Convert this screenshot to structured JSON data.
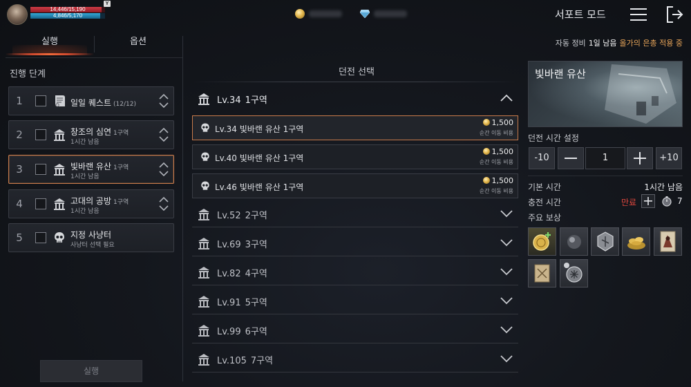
{
  "player": {
    "hp_text": "14,446/15,190",
    "hp_fraction": 0.951,
    "mp_text": "4,846/5,170",
    "mp_fraction": 0.937,
    "badge": "Y"
  },
  "header": {
    "mode_label": "서포트 모드"
  },
  "left": {
    "tabs": [
      {
        "label": "실행",
        "active": true
      },
      {
        "label": "옵션",
        "active": false
      }
    ],
    "section_title": "진행 단계",
    "stages": [
      {
        "num": "1",
        "name": "일일 퀘스트",
        "level": "(12/12)",
        "sub": "",
        "icon": "scroll-icon"
      },
      {
        "num": "2",
        "name": "창조의 심연",
        "level": "1구역",
        "sub": "1시간 남음",
        "icon": "temple-icon"
      },
      {
        "num": "3",
        "name": "빛바랜 유산",
        "level": "1구역",
        "sub": "1시간 남음",
        "icon": "temple-icon"
      },
      {
        "num": "4",
        "name": "고대의 공방",
        "level": "1구역",
        "sub": "1시간 남음",
        "icon": "temple-icon"
      },
      {
        "num": "5",
        "name": "지정 사냥터",
        "level": "",
        "sub": "사냥터 선택 필요",
        "icon": "skull-icon"
      }
    ],
    "run_button": "실행"
  },
  "middle": {
    "title": "던전 선택",
    "open_zone": {
      "level": "Lv.34",
      "name": "1구역"
    },
    "dungeons": [
      {
        "name": "Lv.34 빛바랜 유산 1구역",
        "cost": "1,500",
        "cost_label": "순간 이동 비용"
      },
      {
        "name": "Lv.40 빛바랜 유산 1구역",
        "cost": "1,500",
        "cost_label": "순간 이동 비용"
      },
      {
        "name": "Lv.46 빛바랜 유산 1구역",
        "cost": "1,500",
        "cost_label": "순간 이동 비용"
      }
    ],
    "zones": [
      {
        "level": "Lv.52",
        "name": "2구역"
      },
      {
        "level": "Lv.69",
        "name": "3구역"
      },
      {
        "level": "Lv.82",
        "name": "4구역"
      },
      {
        "level": "Lv.91",
        "name": "5구역"
      },
      {
        "level": "Lv.99",
        "name": "6구역"
      },
      {
        "level": "Lv.105",
        "name": "7구역"
      }
    ]
  },
  "right": {
    "maintenance_label": "자동 정비",
    "maintenance_value": "1일 남음",
    "event_text": "올가의 은총 적용 중",
    "map_title": "빛바랜 유산",
    "time_setting_label": "던전 시간 설정",
    "minus10": "-10",
    "plus10": "+10",
    "hours_value": "1",
    "base_time_label": "기본 시간",
    "base_time_value": "1시간 남음",
    "charge_time_label": "충전 시간",
    "charge_status": "만료",
    "charge_count": "7",
    "rewards_label": "주요 보상",
    "rewards": [
      "gold-coin-reward-icon",
      "dark-orb-reward-icon",
      "silver-rune-reward-icon",
      "gold-pile-reward-icon",
      "monster-card-reward-icon",
      "parchment-scroll-reward-icon",
      "silver-emblem-reward-icon"
    ],
    "accent_color": "#c97b4b",
    "expired_color": "#e0473e"
  }
}
